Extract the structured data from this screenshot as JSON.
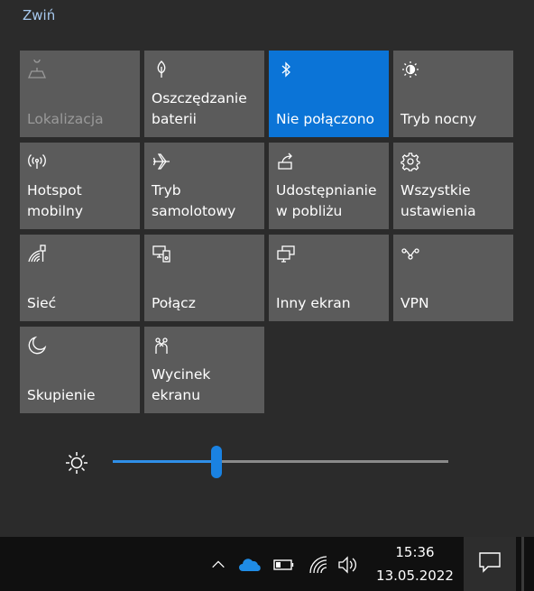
{
  "header": {
    "collapse_label": "Zwiń"
  },
  "tiles": [
    {
      "label": "Lokalizacja",
      "icon": "location-icon",
      "state": "disabled"
    },
    {
      "label": "Oszczędzanie\nbaterii",
      "icon": "battery-saver-icon",
      "state": "off"
    },
    {
      "label": "Nie połączono",
      "icon": "bluetooth-icon",
      "state": "active"
    },
    {
      "label": "Tryb nocny",
      "icon": "night-light-icon",
      "state": "off"
    },
    {
      "label": "Hotspot\nmobilny",
      "icon": "hotspot-icon",
      "state": "off"
    },
    {
      "label": "Tryb\nsamolotowy",
      "icon": "airplane-icon",
      "state": "off"
    },
    {
      "label": "Udostępnianie\nw pobliżu",
      "icon": "nearby-share-icon",
      "state": "off"
    },
    {
      "label": "Wszystkie\nustawienia",
      "icon": "gear-icon",
      "state": "off"
    },
    {
      "label": "Sieć",
      "icon": "network-icon",
      "state": "off"
    },
    {
      "label": "Połącz",
      "icon": "connect-icon",
      "state": "off"
    },
    {
      "label": "Inny ekran",
      "icon": "project-icon",
      "state": "off"
    },
    {
      "label": "VPN",
      "icon": "vpn-icon",
      "state": "off"
    },
    {
      "label": "Skupienie",
      "icon": "focus-assist-icon",
      "state": "off"
    },
    {
      "label": "Wycinek\nekranu",
      "icon": "snip-icon",
      "state": "off"
    }
  ],
  "brightness": {
    "level_percent": 31,
    "icon": "brightness-icon"
  },
  "taskbar": {
    "tray_icons": [
      "chevron-up-icon",
      "onedrive-icon",
      "battery-icon",
      "wifi-icon",
      "volume-icon"
    ],
    "time": "15:36",
    "date": "13.05.2022",
    "notification_icon": "notification-icon"
  },
  "colors": {
    "accent": "#0b74d7",
    "tile": "#5b5b5b",
    "panel": "#2b2b2b",
    "taskbar": "#101010",
    "onedrive": "#1f8ce6"
  }
}
